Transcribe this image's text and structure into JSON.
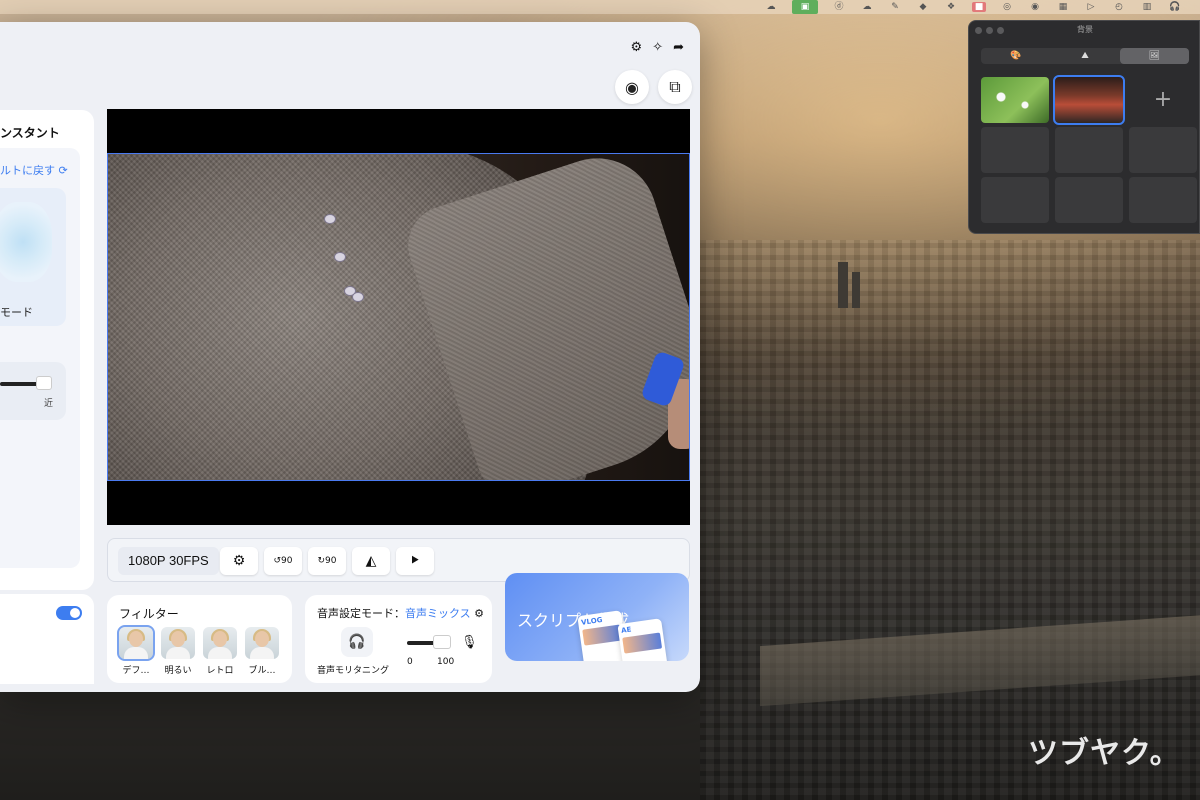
{
  "menubar": {
    "icons": [
      "cloud-icon",
      "finder-icon",
      "app-icon",
      "cloud-icon",
      "pen-icon",
      "box-icon",
      "dropbox-icon",
      "pink-app-icon",
      "green-app-icon",
      "evernote-icon",
      "grid-icon",
      "play-icon",
      "clock-icon",
      "chart-icon",
      "headphones-icon"
    ]
  },
  "app": {
    "assistant_title": "ンスタント",
    "reset_label": "ルトに戻す",
    "mode_label": "モード",
    "slider_near_label": "近",
    "preview": {
      "resolution": "1080P 30FPS"
    },
    "controls": [
      {
        "icon": "gear-icon",
        "glyph": "⚙"
      },
      {
        "icon": "rotate-left-90-icon",
        "glyph": "90"
      },
      {
        "icon": "rotate-right-90-icon",
        "glyph": "90"
      },
      {
        "icon": "flip-horizontal-icon",
        "glyph": "◭"
      },
      {
        "icon": "flip-vertical-icon",
        "glyph": "⯈"
      }
    ],
    "filters": {
      "title": "フィルター",
      "items": [
        {
          "label": "デフ…",
          "selected": true
        },
        {
          "label": "明るい",
          "selected": false
        },
        {
          "label": "レトロ",
          "selected": false
        },
        {
          "label": "ブル…",
          "selected": false
        }
      ]
    },
    "audio": {
      "title": "音声設定モード：",
      "mode": "音声ミックス",
      "monitoring_label": "音声モリタニング",
      "volume_min": "0",
      "volume_max": "100",
      "volume_value": 1.0
    },
    "script": {
      "title": "スクリプト生成",
      "doc_label_1": "VLOG",
      "doc_label_2": "AE"
    }
  },
  "background_panel": {
    "title": "背景",
    "tabs": [
      {
        "icon": "palette-icon",
        "glyph": "🎨",
        "active": false
      },
      {
        "icon": "mountain-icon",
        "glyph": "⛰",
        "active": false
      },
      {
        "icon": "image-icon",
        "glyph": "🖼",
        "active": true
      }
    ],
    "add_label": "+"
  },
  "watermark": "ツブヤク。",
  "colors": {
    "accent": "#3d7df0",
    "panel_dark": "#2c2c2e"
  }
}
